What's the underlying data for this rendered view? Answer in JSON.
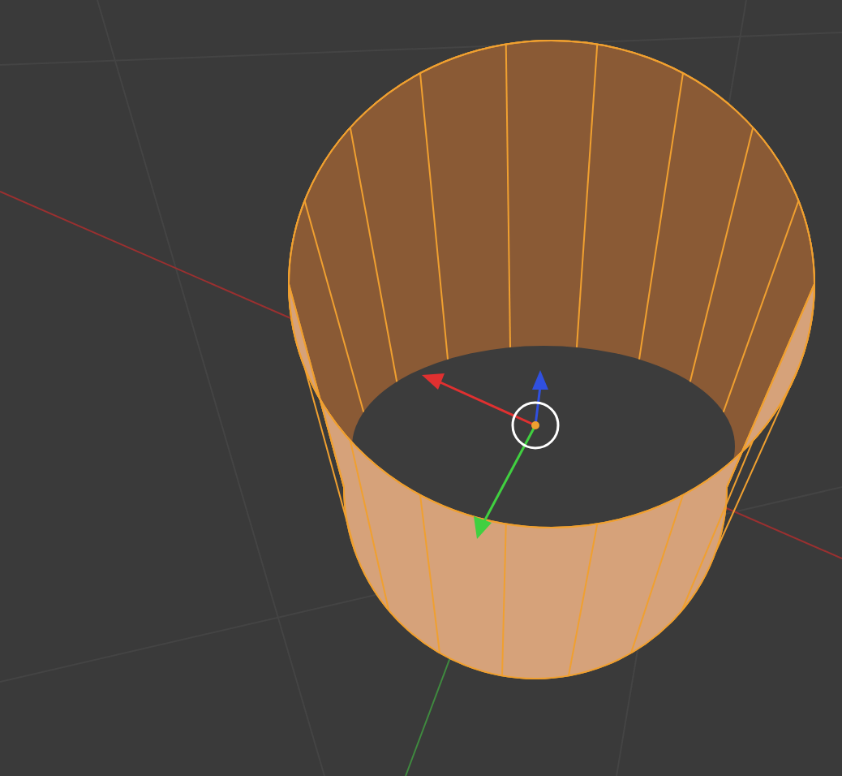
{
  "viewport": {
    "kind": "edit_mesh"
  }
}
